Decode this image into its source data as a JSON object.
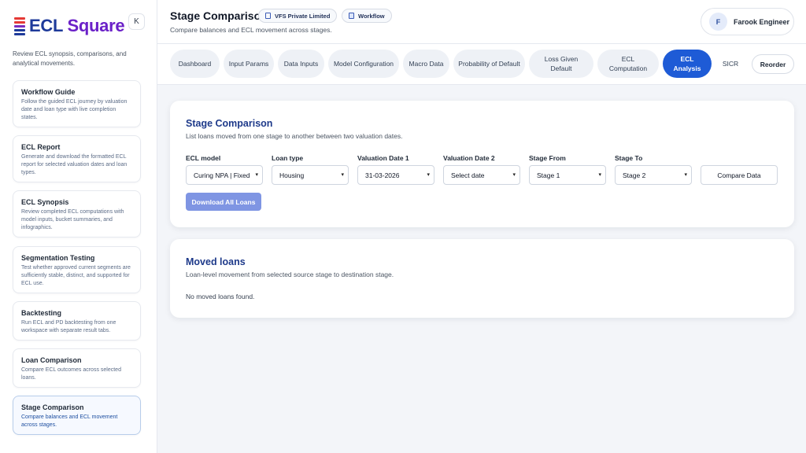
{
  "brand": {
    "name_prefix": "ECL",
    "name_suffix": " Square",
    "collapse_label": "K"
  },
  "sidebar": {
    "intro": "Review ECL synopsis, comparisons, and analytical movements.",
    "items": [
      {
        "title": "Workflow Guide",
        "desc": "Follow the guided ECL journey by valuation date and loan type with live completion states."
      },
      {
        "title": "ECL Report",
        "desc": "Generate and download the formatted ECL report for selected valuation dates and loan types."
      },
      {
        "title": "ECL Synopsis",
        "desc": "Review completed ECL computations with model inputs, bucket summaries, and infographics."
      },
      {
        "title": "Segmentation Testing",
        "desc": "Test whether approved current segments are sufficiently stable, distinct, and supported for ECL use."
      },
      {
        "title": "Backtesting",
        "desc": "Run ECL and PD backtesting from one workspace with separate result tabs."
      },
      {
        "title": "Loan Comparison",
        "desc": "Compare ECL outcomes across selected loans."
      },
      {
        "title": "Stage Comparison",
        "desc": "Compare balances and ECL movement across stages."
      }
    ]
  },
  "header": {
    "title": "Stage Comparison",
    "subtitle": "Compare balances and ECL movement across stages.",
    "chip_company": "VFS Private Limited",
    "chip_workflow": "Workflow",
    "user_initial": "F",
    "user_name": "Farook Engineer"
  },
  "tabs": [
    {
      "label": "Dashboard"
    },
    {
      "label": "Input Params"
    },
    {
      "label": "Data Inputs"
    },
    {
      "label": "Model Configuration"
    },
    {
      "label": "Macro Data"
    },
    {
      "label": "Probability of Default"
    },
    {
      "label": "Loss Given Default"
    },
    {
      "label": "ECL Computation"
    },
    {
      "label": "ECL Analysis"
    },
    {
      "label": "SICR"
    }
  ],
  "reorder_label": "Reorder",
  "stage_card": {
    "title": "Stage Comparison",
    "subtitle": "List loans moved from one stage to another between two valuation dates.",
    "fields": [
      {
        "label": "ECL model",
        "value": "Curing NPA | Fixed"
      },
      {
        "label": "Loan type",
        "value": "Housing"
      },
      {
        "label": "Valuation Date 1",
        "value": "31-03-2026"
      },
      {
        "label": "Valuation Date 2",
        "value": "Select date"
      },
      {
        "label": "Stage From",
        "value": "Stage 1"
      },
      {
        "label": "Stage To",
        "value": "Stage 2"
      }
    ],
    "compare_label": "Compare Data",
    "download_label": "Download All Loans"
  },
  "moved_card": {
    "title": "Moved loans",
    "subtitle": "Loan-level movement from selected source stage to destination stage.",
    "empty_text": "No moved loans found."
  }
}
